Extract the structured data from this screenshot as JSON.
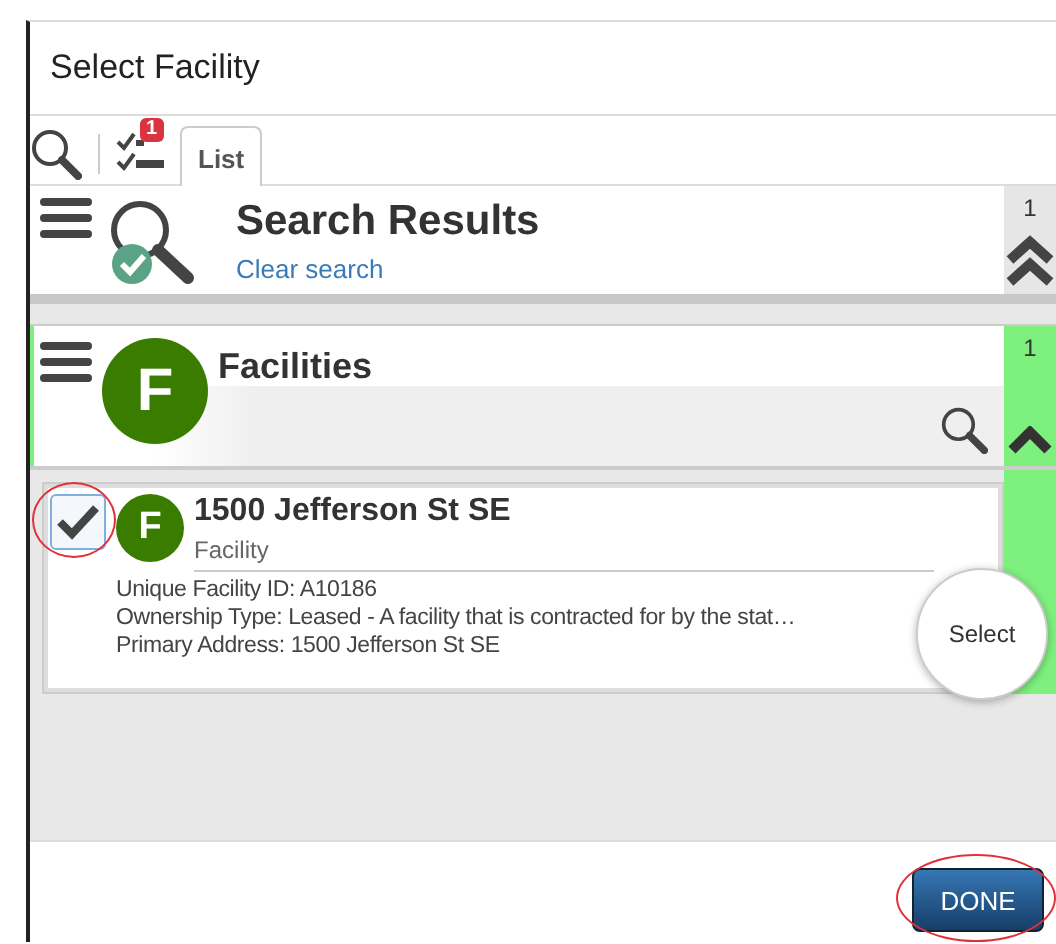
{
  "window": {
    "title": "Select Facility"
  },
  "toolbar": {
    "badge": "1",
    "tabs": [
      {
        "label": "List",
        "selected": true
      }
    ]
  },
  "search_results": {
    "title": "Search Results",
    "link": "Clear search",
    "count": "1"
  },
  "facilities": {
    "title": "Facilities",
    "avatar": "F",
    "count": "1"
  },
  "records": [
    {
      "checked": true,
      "highlighted": true,
      "avatar": "F",
      "title": "1500 Jefferson St SE",
      "subtitle": "Facility",
      "fields": [
        "Unique Facility ID: A10186",
        "Ownership Type: Leased - A facility that is contracted for by the stat…",
        "Primary Address: 1500 Jefferson St SE"
      ],
      "action": "Select"
    }
  ],
  "footer": {
    "button": {
      "label": "DONE",
      "highlighted": true
    }
  }
}
